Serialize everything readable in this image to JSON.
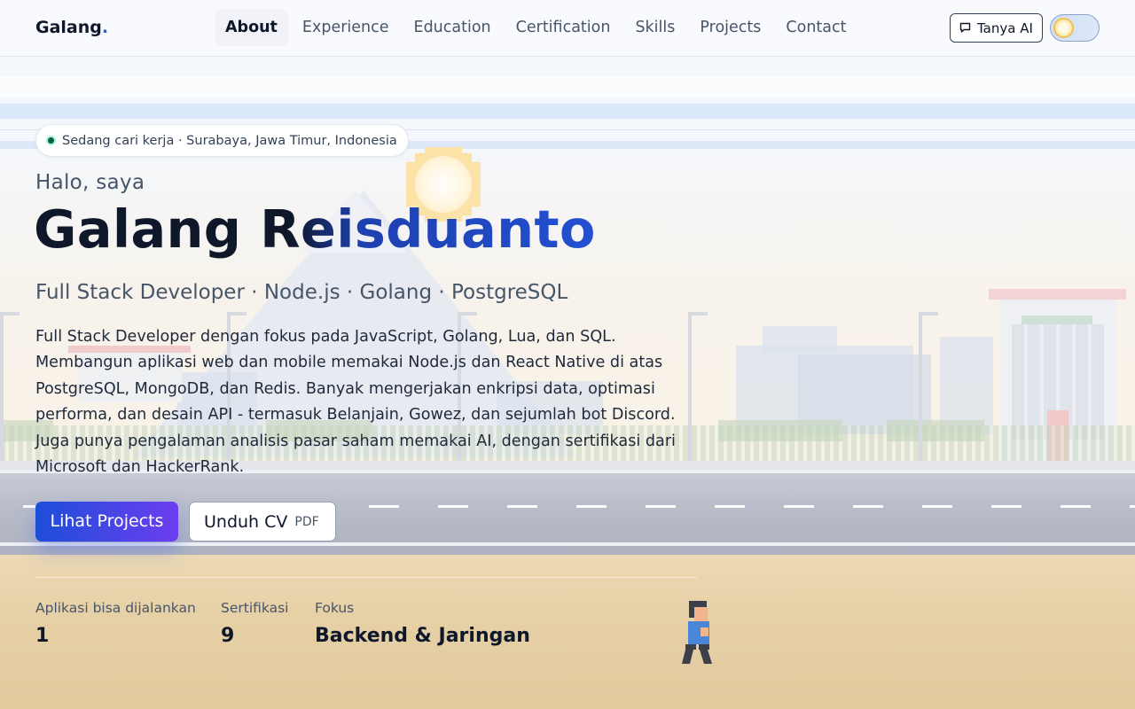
{
  "nav": {
    "brand": "Galang",
    "brand_dot": ".",
    "items": [
      {
        "label": "About",
        "active": true
      },
      {
        "label": "Experience",
        "active": false
      },
      {
        "label": "Education",
        "active": false
      },
      {
        "label": "Certification",
        "active": false
      },
      {
        "label": "Skills",
        "active": false
      },
      {
        "label": "Projects",
        "active": false
      },
      {
        "label": "Contact",
        "active": false
      }
    ],
    "ai_button_label": "Tanya AI",
    "ai_button_icon": "chat-bubble-icon",
    "theme_toggle_icon": "sun-icon"
  },
  "hero": {
    "status": "Sedang cari kerja · Surabaya, Jawa Timur, Indonesia",
    "greeting": "Halo, saya",
    "name": "Galang Reisduanto",
    "tagline": "Full Stack Developer · Node.js · Golang · PostgreSQL",
    "bio": "Full Stack Developer dengan fokus pada JavaScript, Golang, Lua, dan SQL. Membangun aplikasi web dan mobile memakai Node.js dan React Native di atas PostgreSQL, MongoDB, dan Redis. Banyak mengerjakan enkripsi data, optimasi performa, dan desain API - termasuk Belanjain, Gowez, dan sejumlah bot Discord. Juga punya pengalaman analisis pasar saham memakai AI, dengan sertifikasi dari Microsoft dan HackerRank.",
    "primary_cta": "Lihat Projects",
    "secondary_cta": "Unduh CV",
    "secondary_cta_tag": "PDF"
  },
  "stats": [
    {
      "label": "Aplikasi bisa dijalankan",
      "value": "1"
    },
    {
      "label": "Sertifikasi",
      "value": "9"
    },
    {
      "label": "Fokus",
      "value": "Backend & Jaringan"
    }
  ],
  "colors": {
    "accent": "#2563eb",
    "text": "#0f172a",
    "muted": "#475569",
    "cta_gradient_start": "#1d4ed8",
    "cta_gradient_end": "#6d3df0",
    "status_dot": "#065f46"
  }
}
